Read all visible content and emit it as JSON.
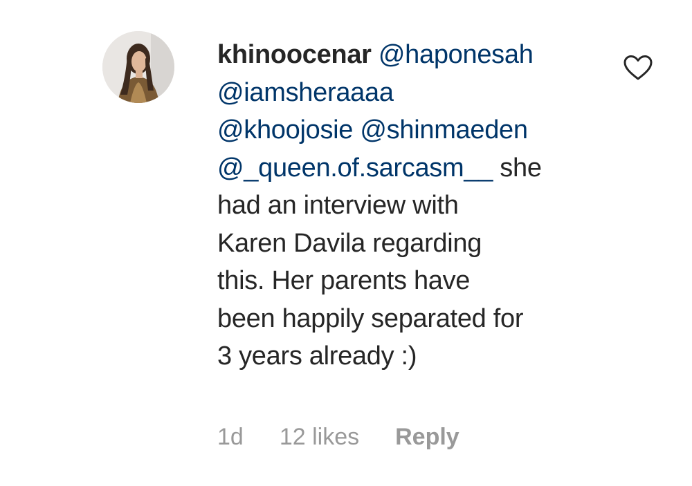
{
  "comment": {
    "username": "khinoocenar",
    "lines": [
      [
        {
          "type": "mention",
          "text": "@haponesah"
        }
      ],
      [
        {
          "type": "mention",
          "text": "@iamsheraaaa"
        }
      ],
      [
        {
          "type": "mention",
          "text": "@khoojosie"
        },
        {
          "type": "text",
          "text": " "
        },
        {
          "type": "mention",
          "text": "@shinmaeden"
        }
      ],
      [
        {
          "type": "mention",
          "text": "@_queen.of.sarcasm__"
        },
        {
          "type": "text",
          "text": " she"
        }
      ],
      [
        {
          "type": "text",
          "text": "had an interview with"
        }
      ],
      [
        {
          "type": "text",
          "text": "Karen Davila regarding"
        }
      ],
      [
        {
          "type": "text",
          "text": "this. Her parents have"
        }
      ],
      [
        {
          "type": "text",
          "text": "been happily separated for"
        }
      ],
      [
        {
          "type": "text",
          "text": "3 years already :)"
        }
      ]
    ],
    "time_ago": "1d",
    "likes": "12 likes",
    "reply_label": "Reply",
    "like_icon": "heart-outline-icon"
  },
  "colors": {
    "text": "#262626",
    "mention": "#003569",
    "meta": "#999999",
    "heart_stroke": "#262626"
  }
}
